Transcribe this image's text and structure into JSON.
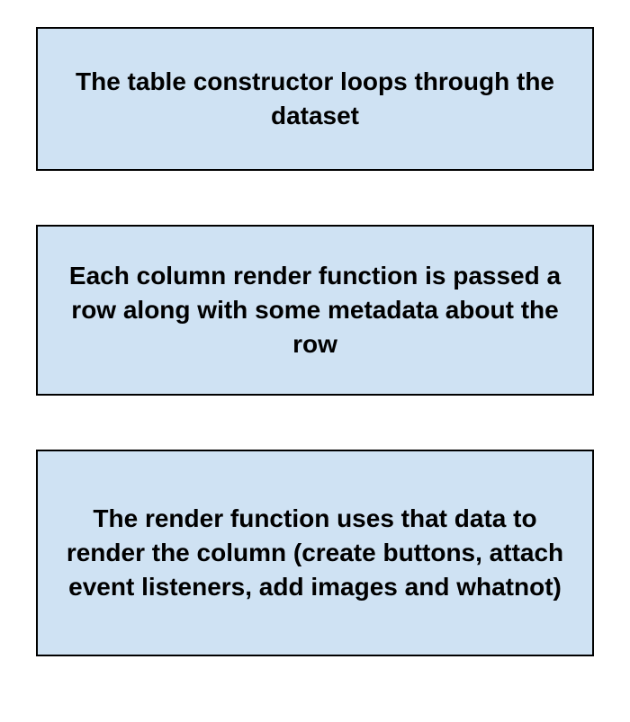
{
  "boxes": [
    {
      "text": "The table constructor loops through the dataset"
    },
    {
      "text": "Each column render function is passed a row along with some metadata about the row"
    },
    {
      "text": "The render function uses that data to render the column (create buttons, attach event listeners, add images and whatnot)"
    }
  ],
  "colors": {
    "box_background": "#cfe2f3",
    "box_border": "#000000",
    "page_background": "#ffffff"
  }
}
